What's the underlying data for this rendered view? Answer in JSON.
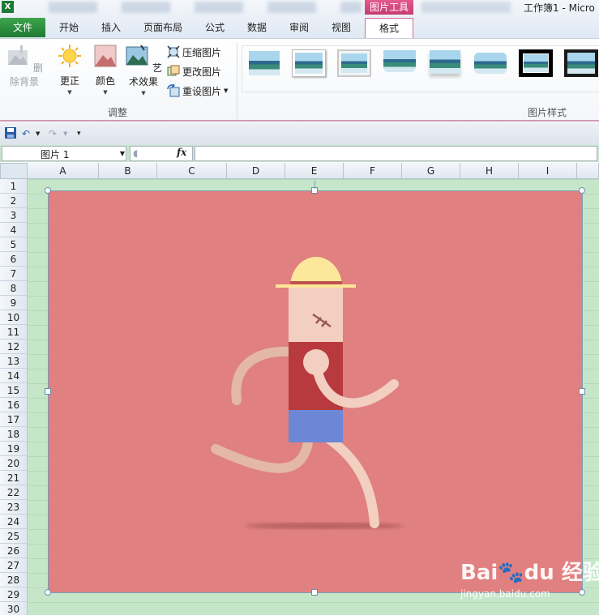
{
  "title_bar": {
    "app_icon": "excel-x-icon",
    "window_title": "工作簿1 - Micro",
    "context_tab_group": "图片工具"
  },
  "tabs": [
    {
      "label": "文件"
    },
    {
      "label": "开始"
    },
    {
      "label": "插入"
    },
    {
      "label": "页面布局"
    },
    {
      "label": "公式"
    },
    {
      "label": "数据"
    },
    {
      "label": "审阅"
    },
    {
      "label": "视图"
    },
    {
      "label": "格式"
    }
  ],
  "ribbon": {
    "adjust_group": {
      "label": "调整",
      "remove_background": "删除背景",
      "corrections": "更正",
      "color": "颜色",
      "artistic_effects": "艺术效果",
      "compress_pictures": "压缩图片",
      "change_picture": "更改图片",
      "reset_picture": "重设图片"
    },
    "picture_styles_group": {
      "label": "图片样式"
    }
  },
  "formula_bar": {
    "name_box": "图片 1",
    "fx_label": "fx",
    "formula": ""
  },
  "columns": [
    "A",
    "B",
    "C",
    "D",
    "E",
    "F",
    "G",
    "H",
    "I"
  ],
  "rows": [
    "1",
    "2",
    "3",
    "4",
    "5",
    "6",
    "7",
    "8",
    "9",
    "10",
    "11",
    "12",
    "13",
    "14",
    "15",
    "16",
    "17",
    "18",
    "19",
    "20",
    "21",
    "22",
    "23",
    "24",
    "25",
    "26",
    "27",
    "28",
    "29",
    "30"
  ],
  "picture": {
    "watermark_logo": "Bai🐾du 经验",
    "watermark_url": "jingyan.baidu.com"
  },
  "colors": {
    "picture_background": "#e08080",
    "hat": "#fde79a",
    "hat_band": "#c0504d",
    "skin": "#f2cfc0",
    "shirt": "#b83a3e",
    "shorts": "#6c87d6",
    "limbs": "#e3b8a4",
    "sheet_background": "#c6e6c9",
    "format_tab_accent": "#d36a95"
  }
}
